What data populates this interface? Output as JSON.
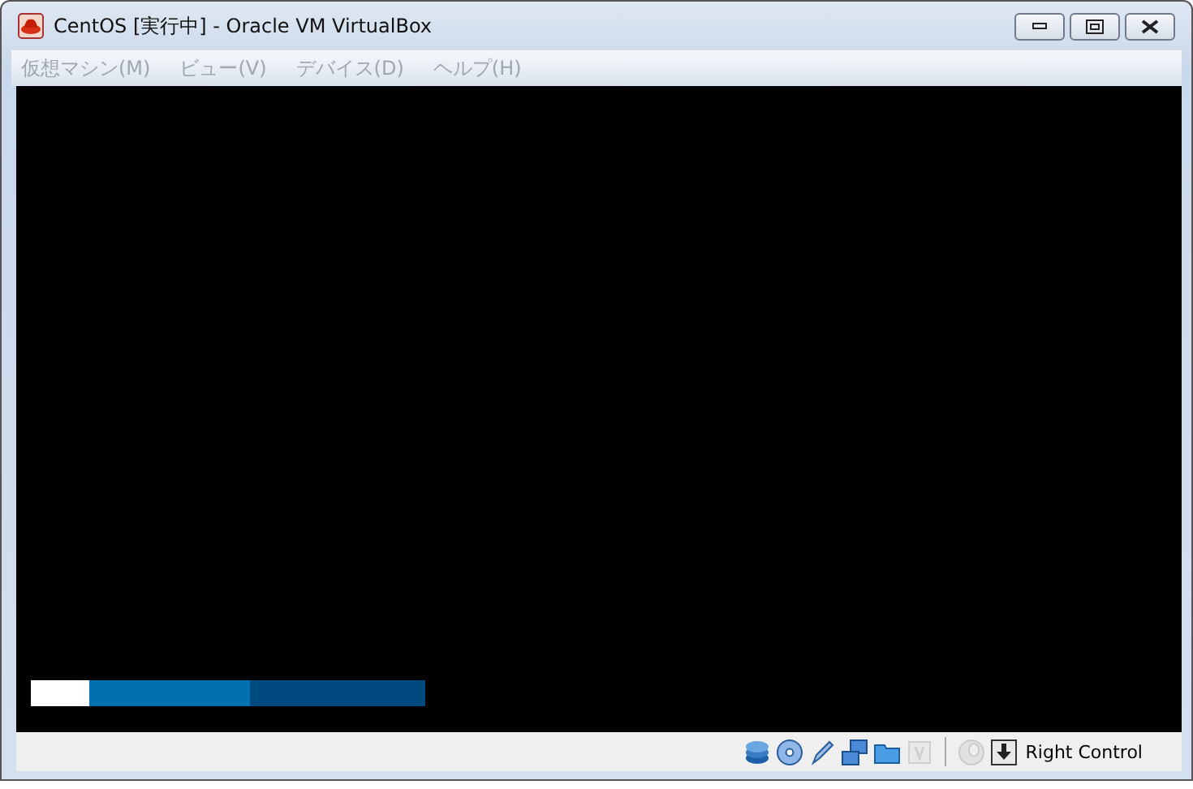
{
  "window": {
    "title": "CentOS [実行中] - Oracle VM VirtualBox"
  },
  "menu": [
    {
      "label": "仮想マシン(M)",
      "disabled": true
    },
    {
      "label": "ビュー(V)",
      "disabled": true
    },
    {
      "label": "デバイス(D)",
      "disabled": true
    },
    {
      "label": "ヘルプ(H)",
      "disabled": true
    }
  ],
  "status_bar": {
    "indicators": [
      {
        "kind": "disk",
        "on": true
      },
      {
        "kind": "optical",
        "on": true
      },
      {
        "kind": "usb",
        "on": true
      },
      {
        "kind": "network",
        "on": true
      },
      {
        "kind": "folder",
        "on": true
      },
      {
        "kind": "chip",
        "on": false
      },
      {
        "kind": "separator"
      },
      {
        "kind": "mouse",
        "on": false
      },
      {
        "kind": "keyboard",
        "on": true
      }
    ],
    "host_key": "Right Control"
  }
}
